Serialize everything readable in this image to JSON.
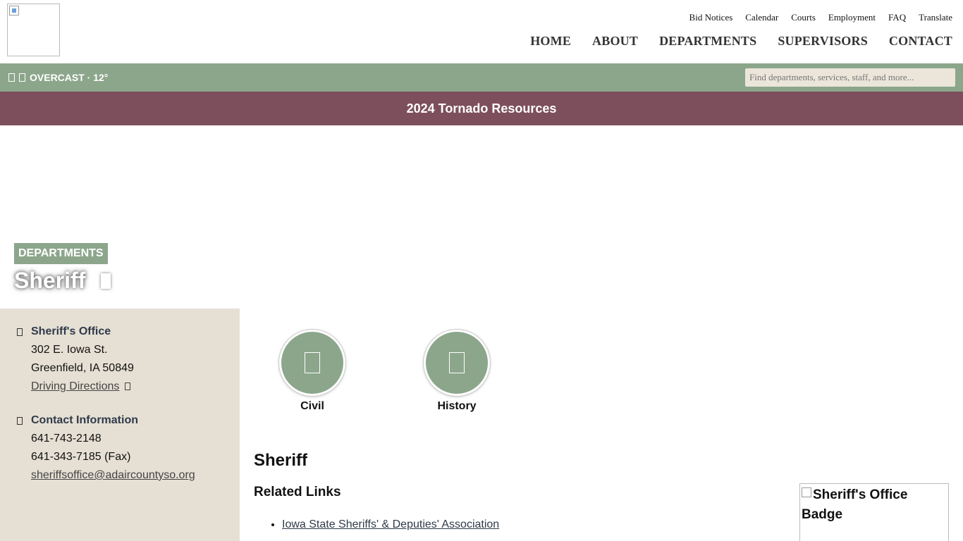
{
  "header": {
    "logo_alt": "",
    "utility_links": [
      "Bid Notices",
      "Calendar",
      "Courts",
      "Employment",
      "FAQ",
      "Translate"
    ],
    "main_nav": [
      "HOME",
      "ABOUT",
      "DEPARTMENTS",
      "SUPERVISORS",
      "CONTACT"
    ]
  },
  "topbar": {
    "weather": "OVERCAST · 12°",
    "search_placeholder": "Find departments, services, staff, and more..."
  },
  "banner": {
    "label": "2024 Tornado Resources"
  },
  "hero": {
    "category": "DEPARTMENTS",
    "title": "Sheriff"
  },
  "sidebar": {
    "office": {
      "heading": "Sheriff's Office",
      "address_line1": "302 E. Iowa St.",
      "address_line2": "Greenfield, IA 50849",
      "directions_label": "Driving Directions"
    },
    "contact": {
      "heading": "Contact Information",
      "phone": "641-743-2148",
      "fax": "641-343-7185 (Fax)",
      "email": "sheriffsoffice@adaircountyso.org"
    }
  },
  "main": {
    "quick_links": [
      {
        "label": "Civil",
        "icon": "civil-icon"
      },
      {
        "label": "History",
        "icon": "history-icon"
      }
    ],
    "heading": "Sheriff",
    "related_heading": "Related Links",
    "related_links": [
      "Iowa State Sheriffs' & Deputies' Association"
    ],
    "badge_alt": "Sheriff's Office Badge"
  },
  "colors": {
    "sage": "#8ca68b",
    "banner": "#7d4f5c",
    "sidebar_bg": "#e6e0d4"
  }
}
